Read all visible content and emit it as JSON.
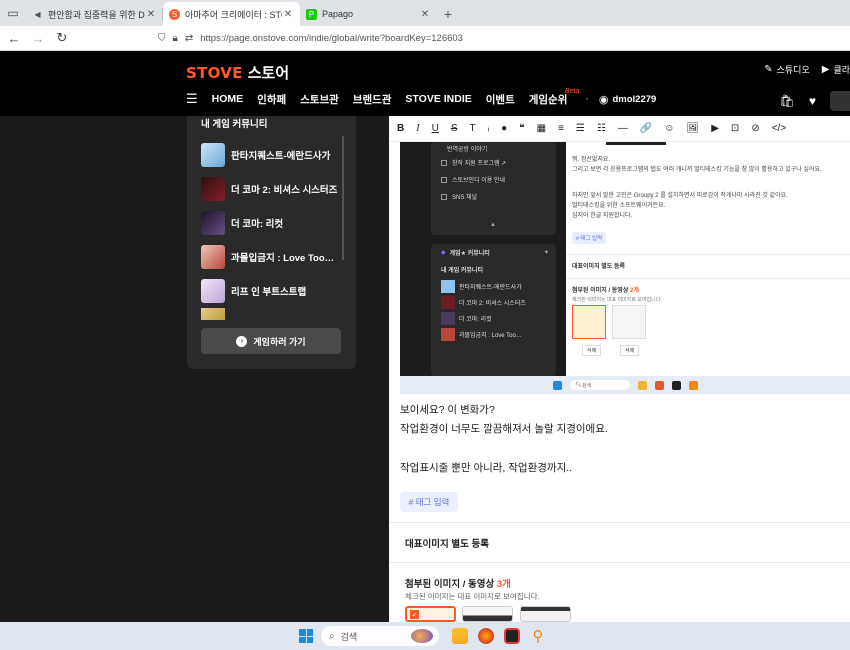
{
  "browser": {
    "tabs": [
      {
        "title": "편안함과 집중력을 위한 Deep",
        "active": false
      },
      {
        "title": "아마추어 크리에이터 : STOVE",
        "active": true
      },
      {
        "title": "Papago",
        "active": false
      }
    ],
    "url": "https://page.onstove.com/indie/global/write?boardKey=126603"
  },
  "site": {
    "logo_en": "STOVE",
    "logo_ko": "스토어",
    "studio_label": "스튜디오",
    "club_label": "클라",
    "nav": [
      "HOME",
      "인하페",
      "스토브관",
      "브랜드관",
      "STOVE INDIE",
      "이벤트",
      "게임순위"
    ],
    "beta_label": "Beta",
    "username": "dmol2279"
  },
  "community": {
    "title": "내 게임 커뮤니티",
    "items": [
      {
        "name": "판타지퀘스트-에란드사가",
        "color": "#7fb7e8"
      },
      {
        "name": "더 코마 2: 비셔스 시스터즈",
        "color": "#6b1c24"
      },
      {
        "name": "더 코마: 리컷",
        "color": "#3b2a4a"
      },
      {
        "name": "과몰입금지 : Love Too…",
        "color": "#b8473a"
      },
      {
        "name": "리프 인 부트스트랩",
        "color": "#d9c8e8"
      }
    ],
    "play_button": "게임하러 가기"
  },
  "embedded": {
    "menu": [
      "번역공방 이야기",
      "창작 지원 프로그램 ↗",
      "스토브인디 이용 안내",
      "SNS 채널"
    ],
    "community_title": "게임★ 커뮤니티",
    "my_community": "내 게임 커뮤니티",
    "list": [
      "판타지퀘스트-에란드사가",
      "더 코마 2: 비셔스 시스터즈",
      "더 코마: 리컷",
      "과몰입금지 : Love Too…"
    ],
    "text_lines": [
      "뭐, 정산없지요.",
      "그리고 보면 각 응용프로그램의 탭도 여러 개니까 멀티태스킹 기능을 참 많이 활용하고 있구나 싶어요.",
      "하지만 앞서 말한 고민은 Groupy 2 를 설치하면서 피로감이 적게나마 사라진 것 같아요.",
      "멀티태스킹을 위한 소프트웨어거든요.",
      "심지어 한글 지원합니다."
    ],
    "tag_label": "# 태그 입력",
    "rep_image": "대표이미지 별도 등록",
    "attach_title": "첨부된 이미지 / 동영상",
    "attach_count": "2개",
    "attach_sub": "체크된 이미지는 대표 이미지로 보여집니다.",
    "delete": "삭제",
    "search": "검색"
  },
  "editor": {
    "toolbar": [
      "B",
      "I",
      "U",
      "S",
      "T",
      "●",
      "❝",
      "▦",
      "≡",
      "☰",
      "☷",
      "—",
      "🔗",
      "☺",
      "🖼",
      "▶",
      "⊡",
      "⊘",
      "</>"
    ],
    "lines": [
      "보이세요? 이 변화가?",
      "작업환경이 너무도 깔끔해져서 놀랄 지경이에요.",
      "작업표시줄 뿐만 아니라, 작업환경까지.."
    ],
    "tag_label": "# 태그 입력",
    "rep_image": "대표이미지 별도 등록",
    "attach_title": "첨부된 이미지 / 동영상",
    "attach_count": "3개",
    "attach_sub": "체크된 이미지는 대표 이미지로 보여집니다."
  },
  "taskbar": {
    "search_placeholder": "검색"
  }
}
